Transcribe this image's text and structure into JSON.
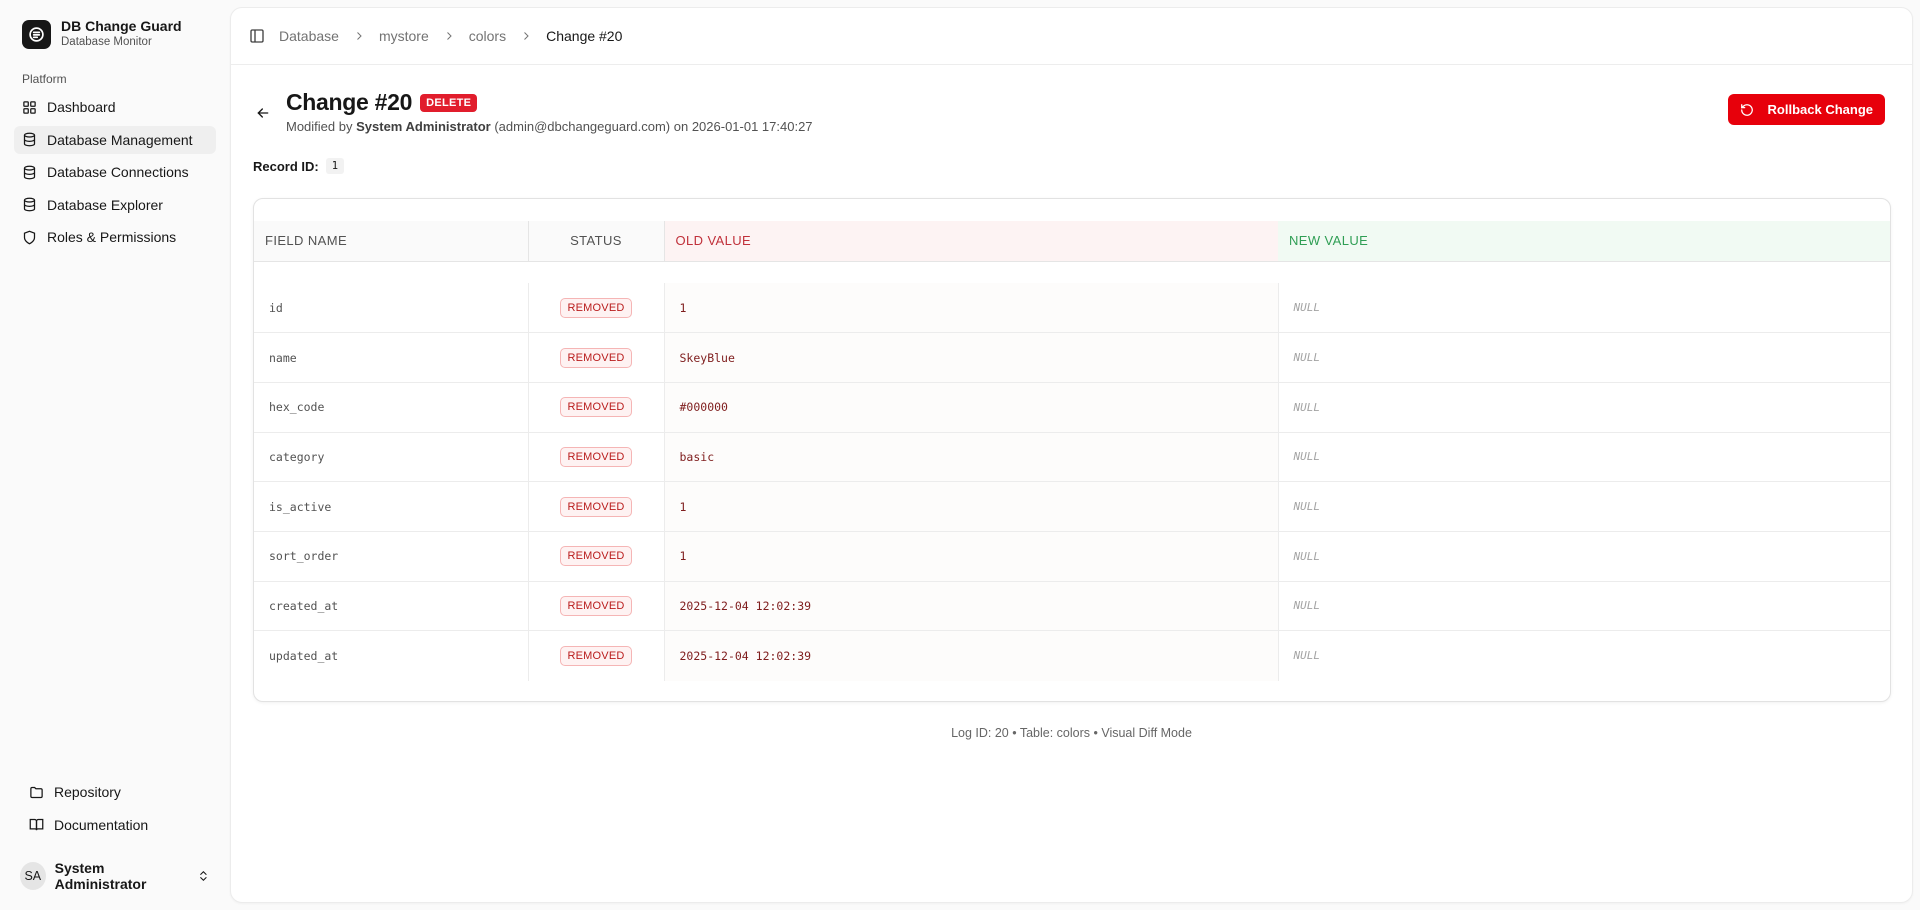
{
  "brand": {
    "title": "DB Change Guard",
    "subtitle": "Database Monitor"
  },
  "sidebar": {
    "group_label": "Platform",
    "items": [
      {
        "label": "Dashboard",
        "icon": "grid-icon"
      },
      {
        "label": "Database Management",
        "icon": "database-icon",
        "active": true
      },
      {
        "label": "Database Connections",
        "icon": "database-icon"
      },
      {
        "label": "Database Explorer",
        "icon": "database-icon"
      },
      {
        "label": "Roles & Permissions",
        "icon": "shield-icon"
      }
    ],
    "bottom_items": [
      {
        "label": "Repository",
        "icon": "folder-icon"
      },
      {
        "label": "Documentation",
        "icon": "book-icon"
      }
    ],
    "user": {
      "initials": "SA",
      "name": "System Administrator"
    }
  },
  "breadcrumb": [
    "Database",
    "mystore",
    "colors",
    "Change #20"
  ],
  "header": {
    "title": "Change #20",
    "badge": "DELETE",
    "meta_prefix": "Modified by",
    "meta_user": "System Administrator",
    "meta_suffix": "(admin@dbchangeguard.com) on 2026-01-01 17:40:27",
    "rollback_label": "Rollback Change"
  },
  "record": {
    "label": "Record ID:",
    "value": "1"
  },
  "diff_table": {
    "headers": [
      "FIELD NAME",
      "STATUS",
      "OLD VALUE",
      "NEW VALUE"
    ],
    "rows": [
      {
        "field": "id",
        "status": "REMOVED",
        "old": "1",
        "new": "NULL"
      },
      {
        "field": "name",
        "status": "REMOVED",
        "old": "SkeyBlue",
        "new": "NULL"
      },
      {
        "field": "hex_code",
        "status": "REMOVED",
        "old": "#000000",
        "new": "NULL"
      },
      {
        "field": "category",
        "status": "REMOVED",
        "old": "basic",
        "new": "NULL"
      },
      {
        "field": "is_active",
        "status": "REMOVED",
        "old": "1",
        "new": "NULL"
      },
      {
        "field": "sort_order",
        "status": "REMOVED",
        "old": "1",
        "new": "NULL"
      },
      {
        "field": "created_at",
        "status": "REMOVED",
        "old": "2025-12-04 12:02:39",
        "new": "NULL"
      },
      {
        "field": "updated_at",
        "status": "REMOVED",
        "old": "2025-12-04 12:02:39",
        "new": "NULL"
      }
    ]
  },
  "footer_note": "Log ID: 20 • Table: colors • Visual Diff Mode",
  "colors": {
    "accent_red": "#e7000b",
    "removed_text": "#b91c1c",
    "new_header": "#2f9e54",
    "old_header": "#c0303a"
  }
}
